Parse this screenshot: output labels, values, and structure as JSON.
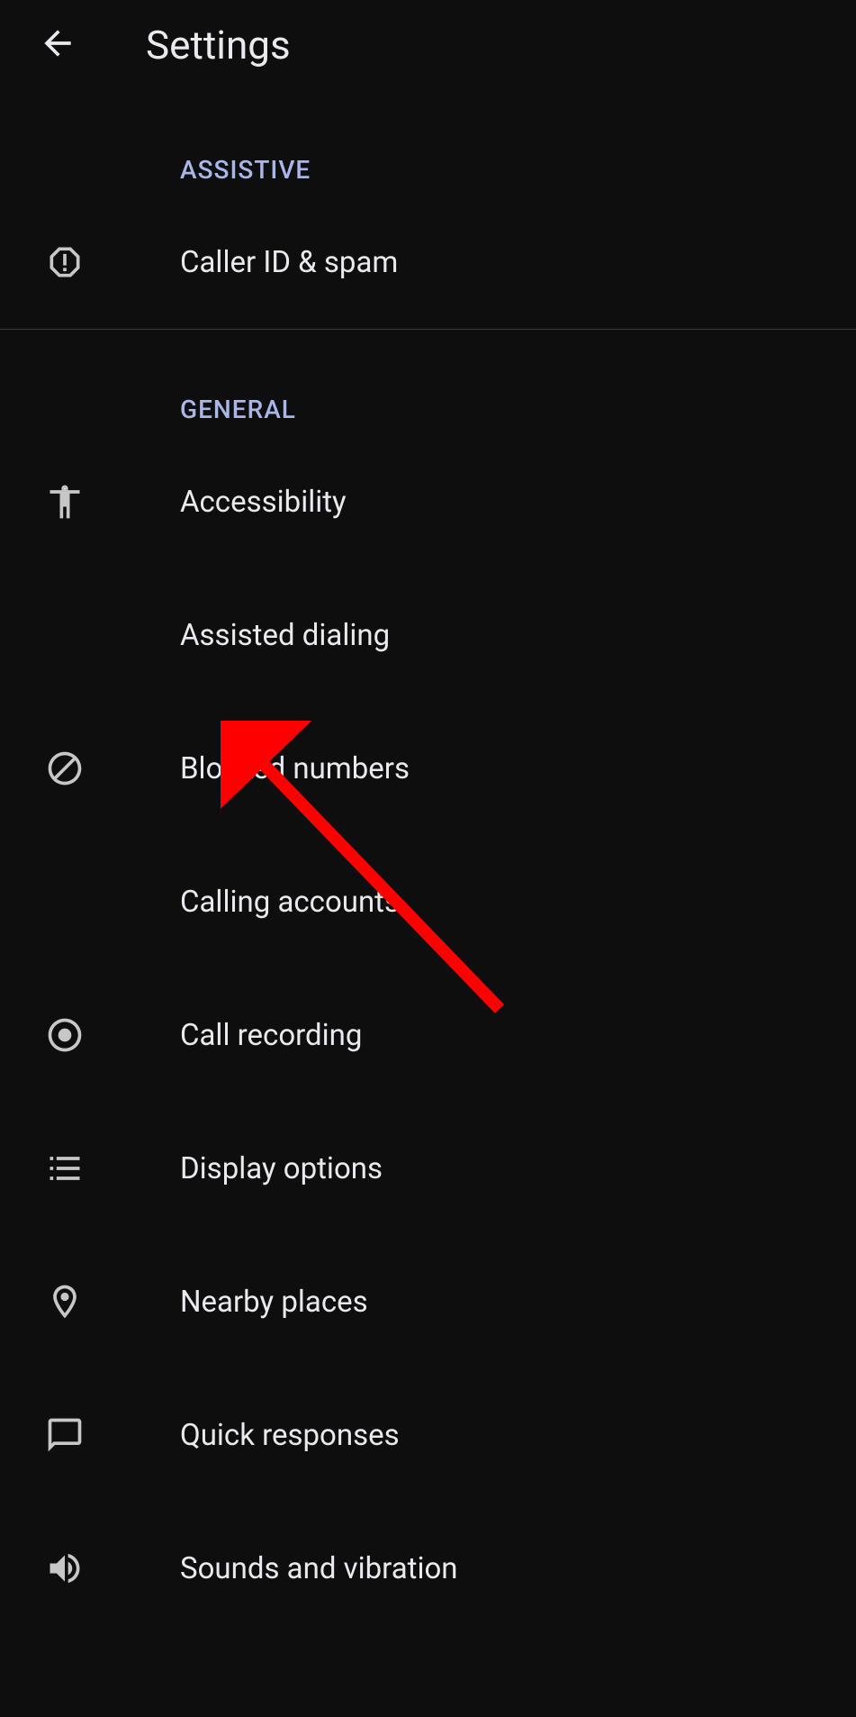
{
  "appbar": {
    "title": "Settings"
  },
  "sections": {
    "assistive": {
      "header": "ASSISTIVE",
      "items": [
        {
          "label": "Caller ID & spam"
        }
      ]
    },
    "general": {
      "header": "GENERAL",
      "items": [
        {
          "label": "Accessibility"
        },
        {
          "label": "Assisted dialing"
        },
        {
          "label": "Blocked numbers"
        },
        {
          "label": "Calling accounts"
        },
        {
          "label": "Call recording"
        },
        {
          "label": "Display options"
        },
        {
          "label": "Nearby places"
        },
        {
          "label": "Quick responses"
        },
        {
          "label": "Sounds and vibration"
        }
      ]
    }
  },
  "annotation": {
    "type": "arrow",
    "color": "#ff0000",
    "target": "Blocked numbers"
  }
}
